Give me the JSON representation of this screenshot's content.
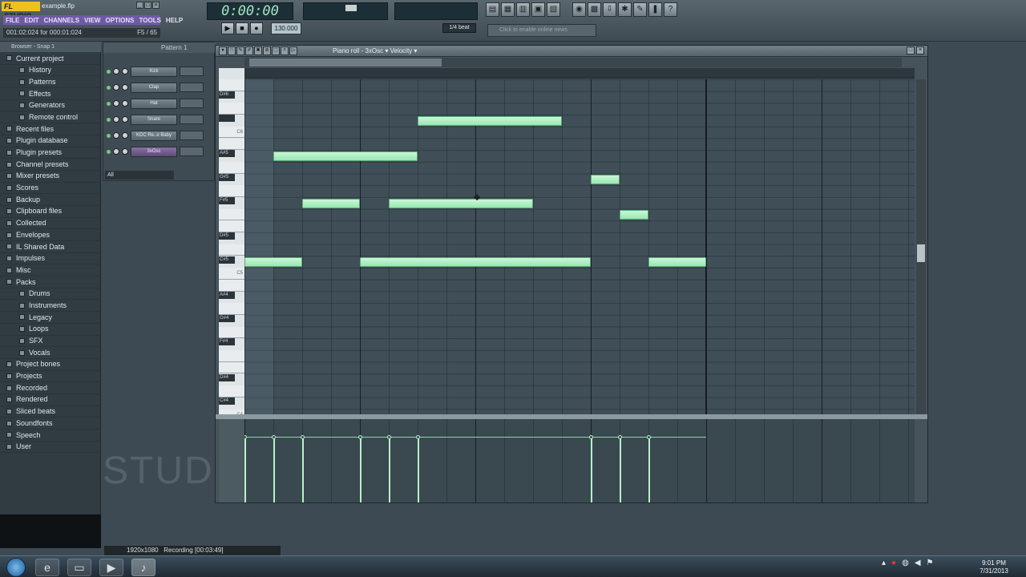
{
  "window": {
    "app_logo": "FL STUDIO",
    "file": "example.flp"
  },
  "menu": [
    "FILE",
    "EDIT",
    "CHANNELS",
    "VIEW",
    "OPTIONS",
    "TOOLS",
    "HELP"
  ],
  "hint": {
    "left": "001:02:024 for 000:01:024",
    "right": "F5 / 65"
  },
  "transport": {
    "time": "0:00:00",
    "tempo": "130.000",
    "play_icon": "play-icon",
    "stop_icon": "stop-icon",
    "record_icon": "record-icon"
  },
  "snap_value": "1/4 beat",
  "news": "Click to enable online news",
  "browser": {
    "header": "Browser - Snap 1",
    "items": [
      {
        "label": "Current project",
        "level": 0
      },
      {
        "label": "History",
        "level": 1
      },
      {
        "label": "Patterns",
        "level": 1
      },
      {
        "label": "Effects",
        "level": 1
      },
      {
        "label": "Generators",
        "level": 1
      },
      {
        "label": "Remote control",
        "level": 1
      },
      {
        "label": "Recent files",
        "level": 0
      },
      {
        "label": "Plugin database",
        "level": 0
      },
      {
        "label": "Plugin presets",
        "level": 0
      },
      {
        "label": "Channel presets",
        "level": 0
      },
      {
        "label": "Mixer presets",
        "level": 0
      },
      {
        "label": "Scores",
        "level": 0
      },
      {
        "label": "Backup",
        "level": 0
      },
      {
        "label": "Clipboard files",
        "level": 0
      },
      {
        "label": "Collected",
        "level": 0
      },
      {
        "label": "Envelopes",
        "level": 0
      },
      {
        "label": "IL Shared Data",
        "level": 0
      },
      {
        "label": "Impulses",
        "level": 0
      },
      {
        "label": "Misc",
        "level": 0
      },
      {
        "label": "Packs",
        "level": 0
      },
      {
        "label": "Drums",
        "level": 1
      },
      {
        "label": "Instruments",
        "level": 1
      },
      {
        "label": "Legacy",
        "level": 1
      },
      {
        "label": "Loops",
        "level": 1
      },
      {
        "label": "SFX",
        "level": 1
      },
      {
        "label": "Vocals",
        "level": 1
      },
      {
        "label": "Project bones",
        "level": 0
      },
      {
        "label": "Projects",
        "level": 0
      },
      {
        "label": "Recorded",
        "level": 0
      },
      {
        "label": "Rendered",
        "level": 0
      },
      {
        "label": "Sliced beats",
        "level": 0
      },
      {
        "label": "Soundfonts",
        "level": 0
      },
      {
        "label": "Speech",
        "level": 0
      },
      {
        "label": "User",
        "level": 0
      }
    ]
  },
  "channel_rack": {
    "title": "Pattern 1",
    "channels": [
      {
        "name": "Kick",
        "selected": false
      },
      {
        "name": "Clap",
        "selected": false
      },
      {
        "name": "Hat",
        "selected": false
      },
      {
        "name": "Snare",
        "selected": false
      },
      {
        "name": "KDC Re..e Baby",
        "selected": false
      },
      {
        "name": "3xOsc",
        "selected": true
      }
    ],
    "filter": "All"
  },
  "watermark": "STUDIO",
  "piano_roll": {
    "title": "Piano roll - 3xOsc",
    "event_target": "Velocity",
    "keys": [
      {
        "label": "D#6",
        "black": true
      },
      {
        "label": "C6",
        "black": false
      },
      {
        "label": "A#5",
        "black": true
      },
      {
        "label": "G#5",
        "black": true
      },
      {
        "label": "F#5",
        "black": true
      },
      {
        "label": "D#5",
        "black": true
      },
      {
        "label": "C#5",
        "black": true
      },
      {
        "label": "C5",
        "black": false
      },
      {
        "label": "A#4",
        "black": true
      },
      {
        "label": "G#4",
        "black": true
      },
      {
        "label": "F#4",
        "black": true
      },
      {
        "label": "D#4",
        "black": true
      },
      {
        "label": "C#4",
        "black": true
      },
      {
        "label": "C4",
        "black": false
      }
    ],
    "notes": [
      {
        "pitch": "C6",
        "start_step": 6,
        "length_steps": 5
      },
      {
        "pitch": "A5",
        "start_step": 1,
        "length_steps": 5
      },
      {
        "pitch": "G5",
        "start_step": 12,
        "length_steps": 1
      },
      {
        "pitch": "F5",
        "start_step": 2,
        "length_steps": 2
      },
      {
        "pitch": "F5",
        "start_step": 5,
        "length_steps": 5
      },
      {
        "pitch": "E5",
        "start_step": 13,
        "length_steps": 1
      },
      {
        "pitch": "C5",
        "start_step": 0,
        "length_steps": 2
      },
      {
        "pitch": "C5",
        "start_step": 4,
        "length_steps": 8
      },
      {
        "pitch": "C5",
        "start_step": 14,
        "length_steps": 2
      }
    ],
    "velocity_steps": [
      0,
      1,
      2,
      4,
      5,
      6,
      12,
      13,
      14
    ],
    "velocity_level": 0.78
  },
  "recording_strip": {
    "resolution": "1920x1080",
    "status": "Recording [00:03:49]"
  },
  "taskbar": {
    "apps": [
      "windows-start-icon",
      "ie-icon",
      "explorer-icon",
      "media-player-icon",
      "fl-studio-icon"
    ],
    "time": "9:01 PM",
    "date": "7/31/2013"
  }
}
